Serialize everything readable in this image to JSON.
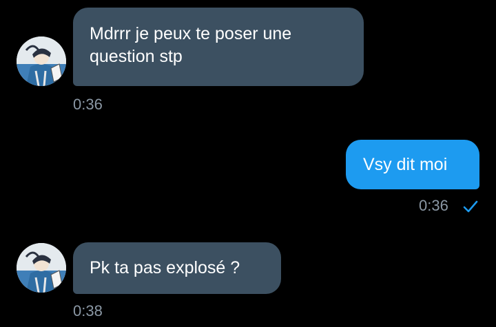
{
  "conversation": {
    "messages": [
      {
        "direction": "incoming",
        "text": "Mdrrr je peux te poser une question stp",
        "time": "0:36"
      },
      {
        "direction": "outgoing",
        "text": "Vsy dit moi",
        "time": "0:36",
        "status_icon": "check-icon"
      },
      {
        "direction": "incoming",
        "text": "Pk ta pas explosé ?",
        "time": "0:38"
      }
    ]
  },
  "colors": {
    "background": "#000000",
    "incoming_bubble": "#3c5061",
    "outgoing_bubble": "#1d9bf0",
    "timestamp": "#8b98a5",
    "read_check": "#1d9bf0"
  },
  "icons": {
    "avatar": "avatar-image",
    "delivered": "check-icon"
  }
}
